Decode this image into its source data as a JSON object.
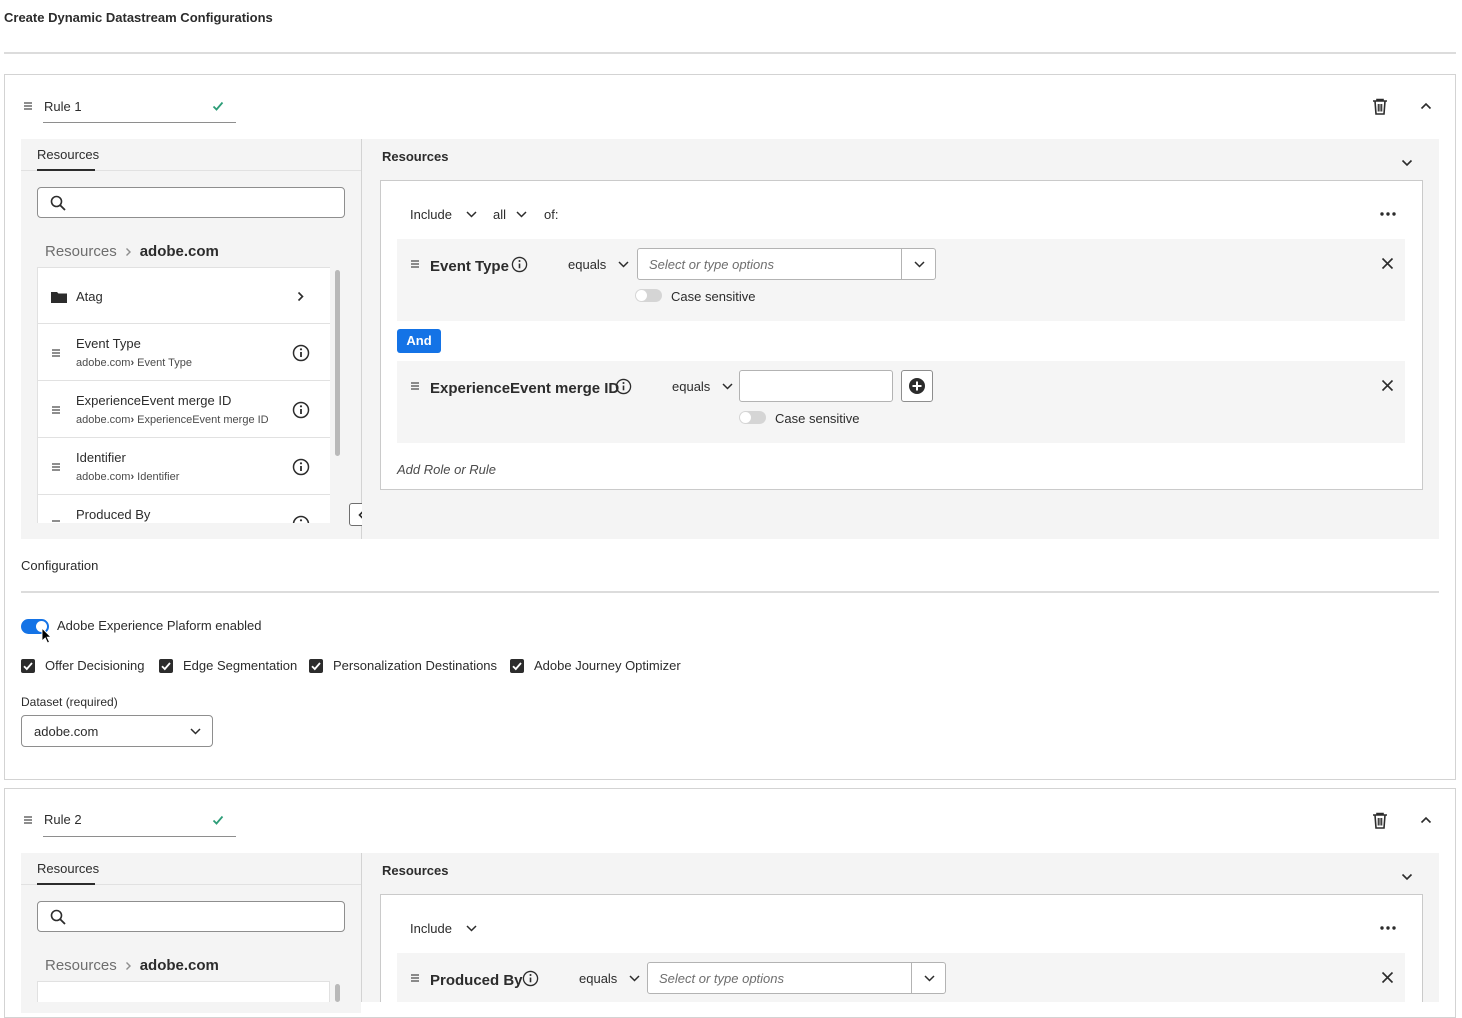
{
  "page": {
    "title": "Create Dynamic Datastream Configurations"
  },
  "rules": [
    {
      "name": "Rule 1",
      "left": {
        "tab": "Resources",
        "search_placeholder": "",
        "breadcrumb": {
          "root": "Resources",
          "current": "adobe.com"
        },
        "items": [
          {
            "title": "Atag",
            "sub": ""
          },
          {
            "title": "Event Type",
            "sub_prefix": "adobe.com",
            "sub_leaf": "Event Type"
          },
          {
            "title": "ExperienceEvent merge ID",
            "sub_prefix": "adobe.com",
            "sub_leaf": "ExperienceEvent merge ID"
          },
          {
            "title": "Identifier",
            "sub_prefix": "adobe.com",
            "sub_leaf": "Identifier"
          },
          {
            "title": "Produced By",
            "sub": ""
          }
        ]
      },
      "right": {
        "title": "Resources",
        "include": "Include",
        "quantifier": "all",
        "of": "of:",
        "conditions": [
          {
            "field": "Event Type",
            "operator": "equals",
            "placeholder": "Select or type options",
            "case_label": "Case sensitive"
          },
          {
            "field": "ExperienceEvent merge ID",
            "operator": "equals",
            "value": "",
            "case_label": "Case sensitive"
          }
        ],
        "and_label": "And",
        "add_rule": "Add Role or Rule"
      },
      "configuration": {
        "title": "Configuration",
        "toggle_label": "Adobe Experience Plaform enabled",
        "toggle_on": true,
        "checkboxes": [
          {
            "label": "Offer Decisioning",
            "checked": true
          },
          {
            "label": "Edge Segmentation",
            "checked": true
          },
          {
            "label": "Personalization Destinations",
            "checked": true
          },
          {
            "label": "Adobe Journey Optimizer",
            "checked": true
          }
        ],
        "dataset_label": "Dataset (required)",
        "dataset_value": "adobe.com"
      }
    },
    {
      "name": "Rule 2",
      "left": {
        "tab": "Resources",
        "search_placeholder": "",
        "breadcrumb": {
          "root": "Resources",
          "current": "adobe.com"
        }
      },
      "right": {
        "title": "Resources",
        "include": "Include",
        "conditions": [
          {
            "field": "Produced By",
            "operator": "equals",
            "placeholder": "Select or type options"
          }
        ]
      }
    }
  ],
  "colors": {
    "accent": "#1473e6",
    "check": "#2d9d78",
    "panel_bg": "#f4f4f4"
  }
}
